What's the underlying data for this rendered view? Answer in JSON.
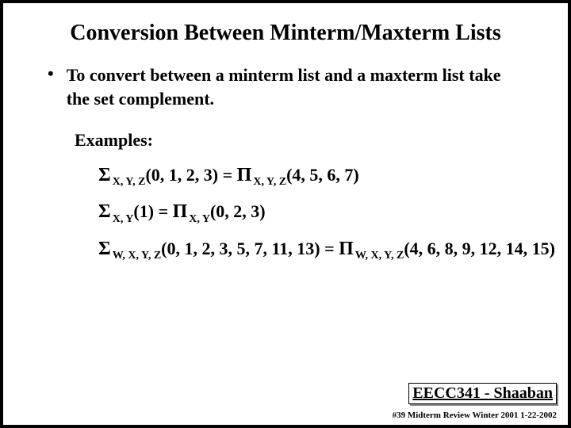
{
  "title": "Conversion Between Minterm/Maxterm Lists",
  "bullet": "To convert between a minterm list and a maxterm list take the set complement.",
  "examples_label": "Examples:",
  "ex1": {
    "sigma": "Σ",
    "sub1": "X, Y, Z",
    "args1": "(0, 1, 2, 3)",
    "eq": " = ",
    "pi": "Π",
    "sub2": "X, Y, Z",
    "args2": "(4, 5, 6, 7)"
  },
  "ex2": {
    "sigma": "Σ",
    "sub1": "X, Y",
    "args1": "(1)",
    "eq": " = ",
    "pi": "Π",
    "sub2": "X, Y",
    "args2": "(0, 2, 3)"
  },
  "ex3": {
    "sigma": "Σ",
    "sub1": "W, X, Y, Z",
    "args1": "(0, 1, 2, 3, 5, 7, 11, 13)",
    "eq": " = ",
    "pi": "Π",
    "sub2": "W, X, Y, Z",
    "args2": "(4, 6, 8, 9, 12, 14, 15)"
  },
  "footer_course": "EECC341 - Shaaban",
  "footer_meta": "#39  Midterm Review  Winter 2001  1-22-2002"
}
